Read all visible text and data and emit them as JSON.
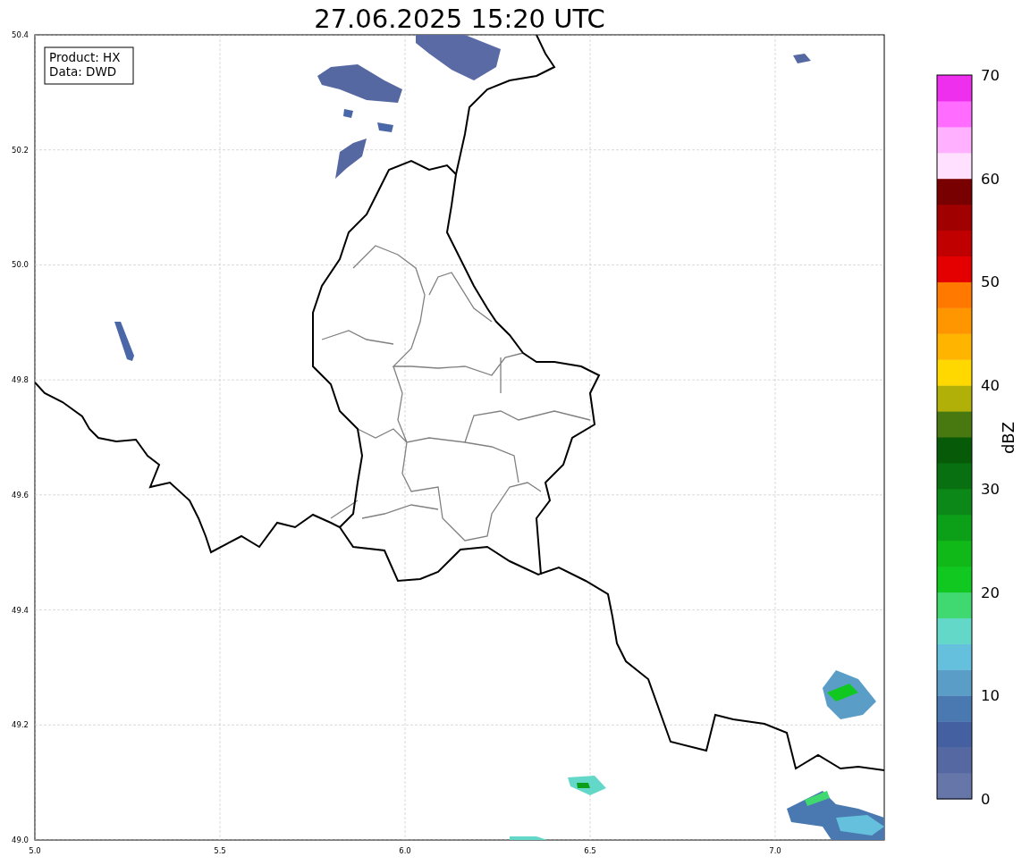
{
  "title": "27.06.2025 15:20 UTC",
  "legend": [
    "Product: HX",
    "Data: DWD"
  ],
  "map": {
    "x_ticks": [
      "5.0",
      "5.5",
      "6.0",
      "6.5",
      "7.0"
    ],
    "y_ticks": [
      "50.4",
      "50.2",
      "50.0",
      "49.8",
      "49.6",
      "49.4",
      "49.2",
      "49.0"
    ]
  },
  "colorbar": {
    "label": "dBZ",
    "ticks": [
      "70",
      "60",
      "50",
      "40",
      "30",
      "20",
      "10",
      "0"
    ],
    "bins": [
      {
        "color": "#6676a8"
      },
      {
        "color": "#5568a2"
      },
      {
        "color": "#4560a0"
      },
      {
        "color": "#4a78b0"
      },
      {
        "color": "#5a9ec8"
      },
      {
        "color": "#64c0dc"
      },
      {
        "color": "#64d8c8"
      },
      {
        "color": "#40d870"
      },
      {
        "color": "#10c820"
      },
      {
        "color": "#10b818"
      },
      {
        "color": "#0ca018"
      },
      {
        "color": "#0c8818"
      },
      {
        "color": "#087010"
      },
      {
        "color": "#065a08"
      },
      {
        "color": "#487810"
      },
      {
        "color": "#b0b008"
      },
      {
        "color": "#ffd800"
      },
      {
        "color": "#ffb400"
      },
      {
        "color": "#ff9600"
      },
      {
        "color": "#ff7800"
      },
      {
        "color": "#e40000"
      },
      {
        "color": "#c00000"
      },
      {
        "color": "#a00000"
      },
      {
        "color": "#780000"
      },
      {
        "color": "#ffe0ff"
      },
      {
        "color": "#ffb0ff"
      },
      {
        "color": "#ff6cff"
      },
      {
        "color": "#ee30ee"
      }
    ]
  }
}
